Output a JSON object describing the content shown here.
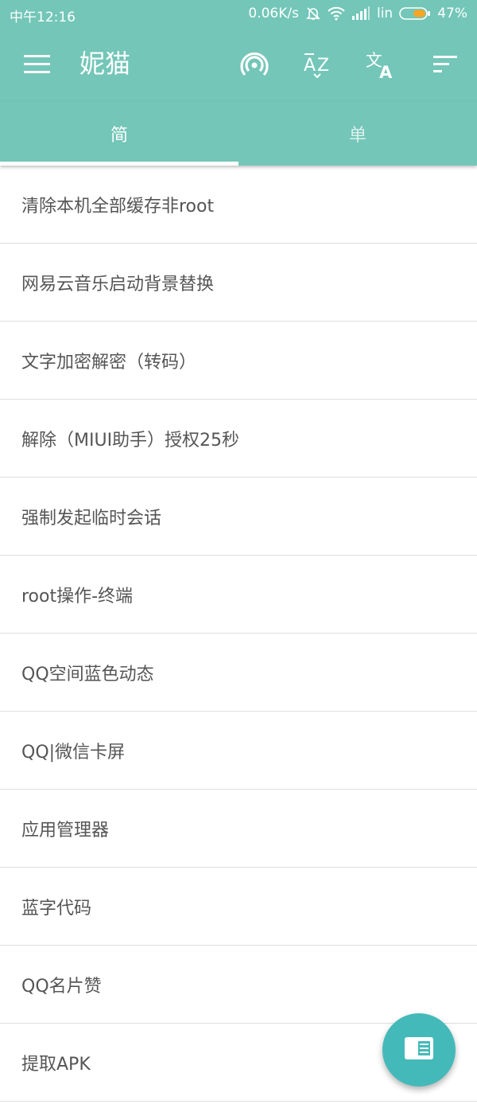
{
  "status_bar": {
    "time": "中午12:16",
    "network_speed": "0.06K/s",
    "signal_text": "lin",
    "battery": "47%",
    "icons": [
      "bell-off-icon",
      "wifi-icon",
      "signal-icon",
      "battery-icon"
    ]
  },
  "app_bar": {
    "title": "妮猫",
    "menu_icon": "hamburger-menu-icon",
    "actions": [
      "broadcast-icon",
      "sort-az-icon",
      "translate-icon",
      "sort-icon"
    ]
  },
  "tabs": [
    {
      "label": "简",
      "active": true
    },
    {
      "label": "单",
      "active": false
    }
  ],
  "items": [
    "清除本机全部缓存非root",
    "网易云音乐启动背景替换",
    "文字加密解密（转码）",
    "解除（MIUI助手）授权25秒",
    "强制发起临时会话",
    "root操作-终端",
    "QQ空间蓝色动态",
    "QQ|微信卡屏",
    "应用管理器",
    "蓝字代码",
    "QQ名片赞",
    "提取APK"
  ],
  "fab": {
    "icon": "reader-icon"
  },
  "colors": {
    "primary": "#73c6b8",
    "fab": "#44b9ba",
    "battery_fill": "#f5a623"
  }
}
